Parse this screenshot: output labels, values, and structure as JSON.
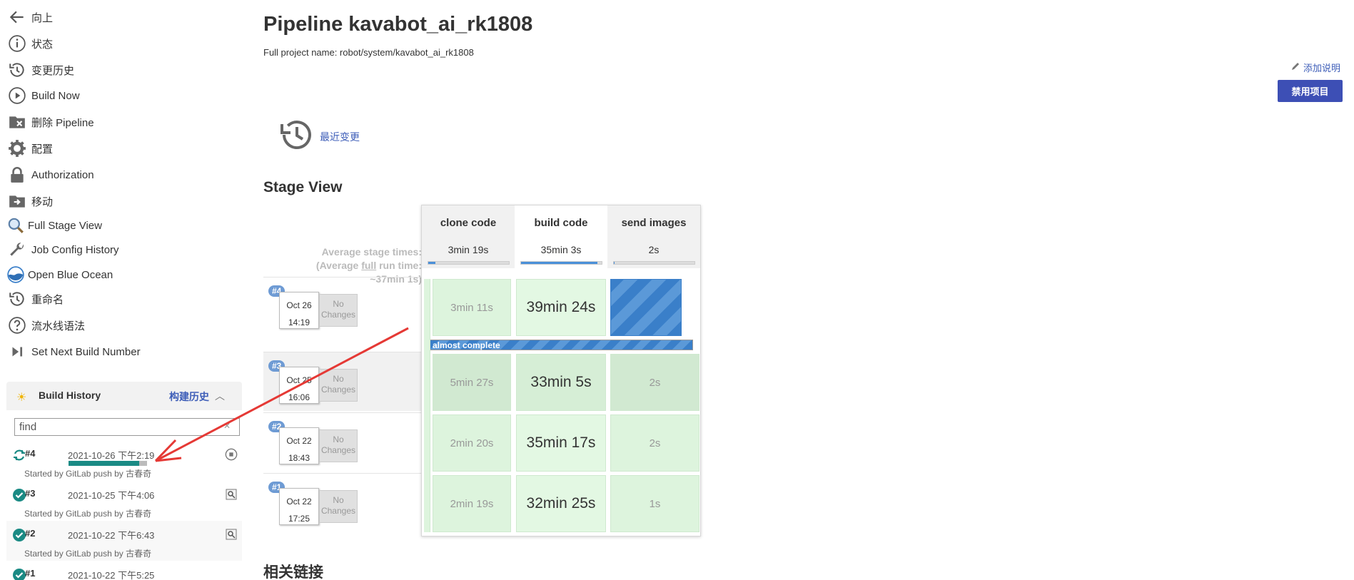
{
  "sidebar": {
    "items": [
      {
        "label": "向上",
        "icon": "arrow-left-icon"
      },
      {
        "label": "状态",
        "icon": "info-icon"
      },
      {
        "label": "变更历史",
        "icon": "history-icon"
      },
      {
        "label": "Build Now",
        "icon": "play-icon"
      },
      {
        "label": "删除 Pipeline",
        "icon": "folder-delete-icon"
      },
      {
        "label": "配置",
        "icon": "gear-icon"
      },
      {
        "label": "Authorization",
        "icon": "lock-icon"
      },
      {
        "label": "移动",
        "icon": "move-icon"
      },
      {
        "label": "Full Stage View",
        "icon": "magnifier-icon"
      },
      {
        "label": "Job Config History",
        "icon": "wrench-icon"
      },
      {
        "label": "Open Blue Ocean",
        "icon": "blue-ocean-icon"
      },
      {
        "label": "重命名",
        "icon": "history-icon"
      },
      {
        "label": "流水线语法",
        "icon": "question-icon"
      },
      {
        "label": "Set Next Build Number",
        "icon": "next-icon"
      }
    ]
  },
  "build_history": {
    "title": "Build History",
    "link": "构建历史",
    "search_placeholder": "find",
    "search_value": "find",
    "builds": [
      {
        "number": "#4",
        "date": "2021-10-26 下午2:19",
        "cause": "Started by GitLab push by 古春奇",
        "status": "running",
        "progress": 0.9
      },
      {
        "number": "#3",
        "date": "2021-10-25 下午4:06",
        "cause": "Started by GitLab push by 古春奇",
        "status": "success"
      },
      {
        "number": "#2",
        "date": "2021-10-22 下午6:43",
        "cause": "Started by GitLab push by 古春奇",
        "status": "success"
      },
      {
        "number": "#1",
        "date": "2021-10-22 下午5:25",
        "status": "success"
      }
    ]
  },
  "main": {
    "title": "Pipeline kavabot_ai_rk1808",
    "full_name": "Full project name: robot/system/kavabot_ai_rk1808",
    "add_description": "添加说明",
    "disable_button": "禁用项目",
    "recent_changes": "最近变更",
    "stage_view_title": "Stage View",
    "related_links_title": "相关链接"
  },
  "stage_view": {
    "stages": [
      "clone code",
      "build code",
      "send images"
    ],
    "avg_label_line1": "Average stage times:",
    "avg_label_line2a": "(Average ",
    "avg_label_line2b": "full",
    "avg_label_line2c": " run time:",
    "avg_label_line3": "~37min 1s)",
    "avg_times": [
      "3min 19s",
      "35min 3s",
      "2s"
    ],
    "avg_progress": [
      0.09,
      0.95,
      0.01
    ],
    "almost_complete": "almost complete",
    "no_changes_line1": "No",
    "no_changes_line2": "Changes",
    "runs": [
      {
        "badge": "#4",
        "date": "Oct 26",
        "time": "14:19",
        "cells": [
          "3min 11s",
          "39min 24s",
          ""
        ]
      },
      {
        "badge": "#3",
        "date": "Oct 25",
        "time": "16:06",
        "cells": [
          "5min 27s",
          "33min 5s",
          "2s"
        ]
      },
      {
        "badge": "#2",
        "date": "Oct 22",
        "time": "18:43",
        "cells": [
          "2min 20s",
          "35min 17s",
          "2s"
        ]
      },
      {
        "badge": "#1",
        "date": "Oct 22",
        "time": "17:25",
        "cells": [
          "2min 19s",
          "32min 25s",
          "1s"
        ]
      }
    ]
  },
  "colors": {
    "accent": "#3e5eb8",
    "button": "#3d4fb5",
    "success": "#1a8a84",
    "stage_success_bg": "#ddf4dd",
    "running_blue": "#3a7fc9",
    "annotation_arrow": "#e53935"
  }
}
